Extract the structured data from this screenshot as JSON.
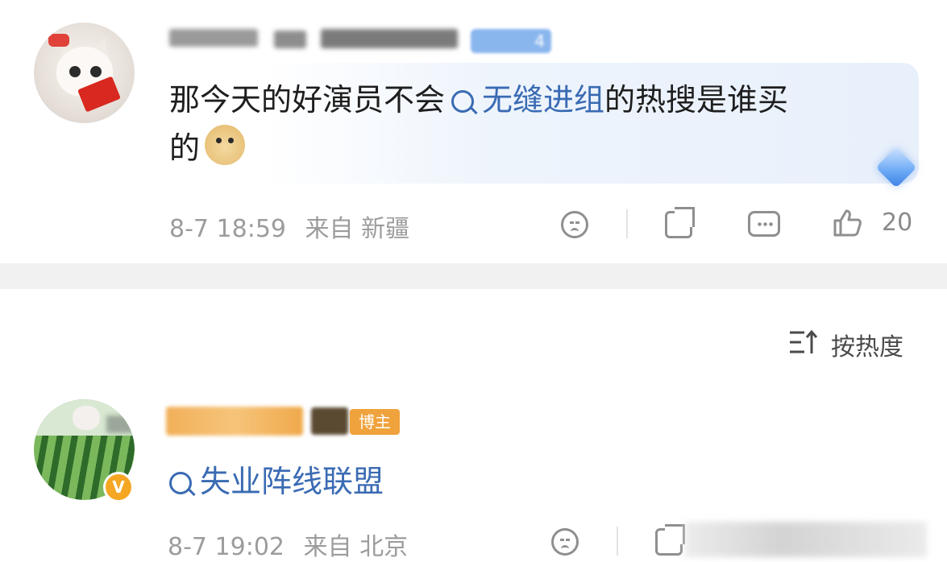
{
  "comment1": {
    "text_before": "那今天的好演员不会",
    "topic": "无缝进组",
    "text_after_line1": "的热搜是谁买",
    "text_line2": "的",
    "badge_level": "4",
    "timestamp": "8-7 18:59",
    "location": "来自 新疆",
    "like_count": "20",
    "emoji": "doge"
  },
  "sort": {
    "label": "按热度"
  },
  "comment2": {
    "blogger_tag": "博主",
    "topic": "失业阵线联盟",
    "verified_badge": "V",
    "timestamp": "8-7 19:02",
    "location": "来自 北京"
  },
  "colors": {
    "topic_link": "#3a6bb3",
    "meta_gray": "#9c9c9c",
    "separator": "#f1f1f2",
    "verified": "#f5a623"
  },
  "icons": {
    "dislike": "sad-face-icon",
    "share": "share-icon",
    "reply": "comment-icon",
    "like": "thumbs-up-icon",
    "sort": "sort-icon"
  }
}
